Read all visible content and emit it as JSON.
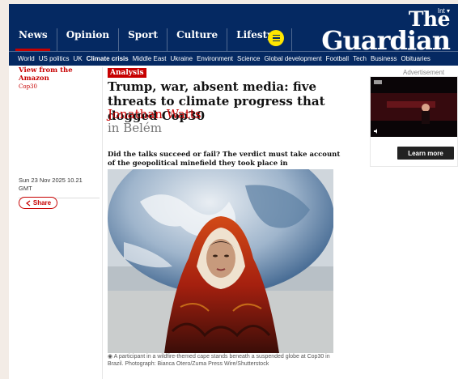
{
  "masthead": {
    "edition": "Int",
    "logo_line1": "The",
    "logo_line2": "Guardian",
    "pillars": [
      "News",
      "Opinion",
      "Sport",
      "Culture",
      "Lifestyle"
    ],
    "subnav": [
      "World",
      "US politics",
      "UK",
      "Climate crisis",
      "Middle East",
      "Ukraine",
      "Environment",
      "Science",
      "Global development",
      "Football",
      "Tech",
      "Business",
      "Obituaries"
    ],
    "subnav_active": "Climate crisis"
  },
  "article": {
    "series": "View from the Amazon",
    "series_sub": "Cop30",
    "badge": "Analysis",
    "headline": "Trump, war, absent media: five threats to climate progress that dogged Cop30",
    "author": "Jonathan Watts",
    "location": "in Belém",
    "standfirst": "Did the talks succeed or fail? The verdict must take account of the geopolitical minefield they took place in",
    "date_line1": "Sun 23 Nov 2025 10.21",
    "date_line2": "GMT",
    "share_label": "Share",
    "caption": "A participant in a wildfire-themed cape stands beneath a suspended globe at Cop30 in Brazil. Photograph: Bianca Otero/Zuma Press Wire/Shutterstock"
  },
  "ad": {
    "label": "Advertisement",
    "cta": "Learn more"
  },
  "colors": {
    "brand_navy": "#052962",
    "news_red": "#c70000",
    "menu_yellow": "#ffe500"
  },
  "icons": [
    "chevron-down-icon",
    "menu-icon",
    "camera-icon",
    "share-icon",
    "mute-icon"
  ]
}
